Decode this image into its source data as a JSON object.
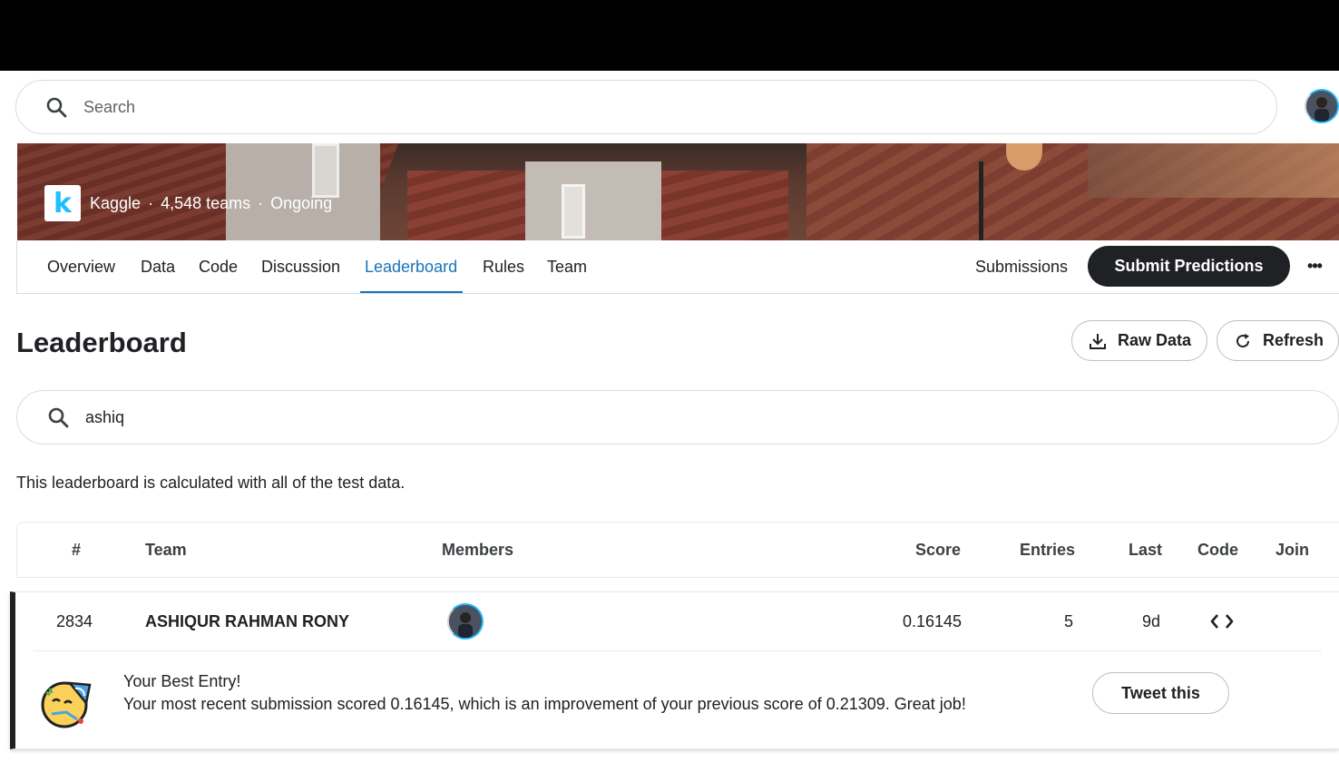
{
  "search": {
    "placeholder": "Search"
  },
  "competition": {
    "host": "Kaggle",
    "teams": "4,548 teams",
    "status": "Ongoing",
    "separator": "·"
  },
  "tabs": [
    {
      "label": "Overview"
    },
    {
      "label": "Data"
    },
    {
      "label": "Code"
    },
    {
      "label": "Discussion"
    },
    {
      "label": "Leaderboard"
    },
    {
      "label": "Rules"
    },
    {
      "label": "Team"
    }
  ],
  "actions": {
    "submissions_label": "Submissions",
    "submit_label": "Submit Predictions",
    "more_label": "•••"
  },
  "leaderboard": {
    "title": "Leaderboard",
    "raw_data_label": "Raw Data",
    "refresh_label": "Refresh",
    "filter_value": "ashiq",
    "note": "This leaderboard is calculated with all of the test data."
  },
  "table": {
    "headers": {
      "rank": "#",
      "team": "Team",
      "members": "Members",
      "score": "Score",
      "entries": "Entries",
      "last": "Last",
      "code": "Code",
      "join": "Join"
    },
    "rows": [
      {
        "rank": "2834",
        "team": "ASHIQUR RAHMAN RONY",
        "score": "0.16145",
        "entries": "5",
        "last": "9d"
      }
    ]
  },
  "best_entry": {
    "title": "Your Best Entry!",
    "message": "Your most recent submission scored 0.16145, which is an improvement of your previous score of 0.21309. Great job!",
    "tweet_label": "Tweet this"
  },
  "colors": {
    "accent": "#1a73b8",
    "kaggle_blue": "#20beff",
    "dark_button": "#202124"
  }
}
